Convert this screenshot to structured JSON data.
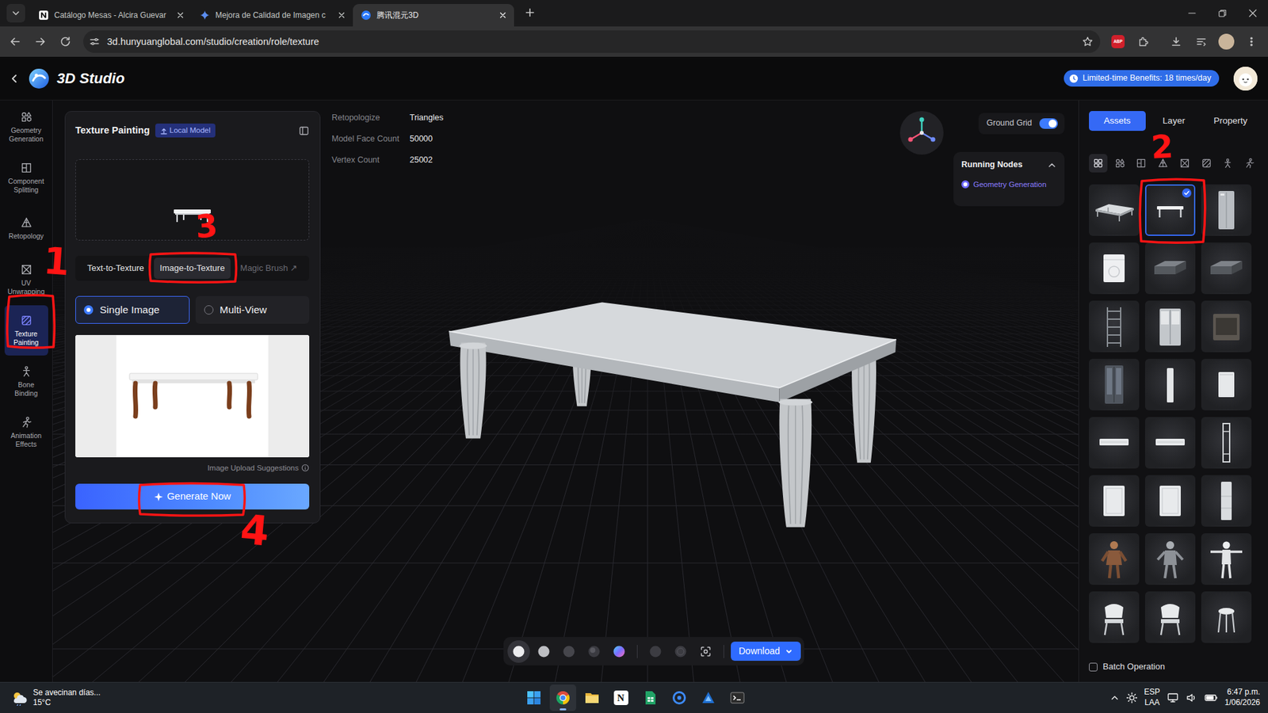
{
  "browser": {
    "tabs": [
      {
        "label": "Catálogo Mesas - Alcira Guevar",
        "selected": false
      },
      {
        "label": "Mejora de Calidad de Imagen c",
        "selected": false
      },
      {
        "label": "腾讯混元3D",
        "selected": true
      }
    ],
    "url": "3d.hunyuanglobal.com/studio/creation/role/texture",
    "extension_badge": "ABP"
  },
  "app": {
    "title": "3D Studio",
    "benefits": "Limited-time Benefits: 18 times/day"
  },
  "rail": [
    {
      "label": "Geometry Generation",
      "kind": "geometry",
      "selected": false
    },
    {
      "label": "Component Splitting",
      "kind": "component",
      "selected": false
    },
    {
      "label": "Retopology",
      "kind": "retopo",
      "selected": false
    },
    {
      "label": "UV Unwrapping",
      "kind": "uv",
      "selected": false
    },
    {
      "label": "Texture Painting",
      "kind": "texture",
      "selected": true
    },
    {
      "label": "Bone Binding",
      "kind": "bone",
      "selected": false
    },
    {
      "label": "Animation Effects",
      "kind": "animation",
      "selected": false
    }
  ],
  "panel": {
    "title": "Texture Painting",
    "badge": "Local Model",
    "modes": [
      {
        "label": "Text-to-Texture",
        "selected": false,
        "disabled": false
      },
      {
        "label": "Image-to-Texture",
        "selected": true,
        "disabled": false
      },
      {
        "label": "Magic Brush ↗",
        "selected": false,
        "disabled": true
      }
    ],
    "views": [
      {
        "label": "Single Image",
        "selected": true
      },
      {
        "label": "Multi-View",
        "selected": false
      }
    ],
    "hint": "Image Upload Suggestions",
    "generate": "Generate Now"
  },
  "stats": [
    {
      "label": "Retopologize",
      "value": "Triangles"
    },
    {
      "label": "Model Face Count",
      "value": "50000"
    },
    {
      "label": "Vertex Count",
      "value": "25002"
    }
  ],
  "ground_grid": {
    "label": "Ground Grid",
    "on": true
  },
  "running_nodes": {
    "title": "Running Nodes",
    "expanded": true,
    "items": [
      {
        "label": "Geometry Generation",
        "running": true
      }
    ]
  },
  "toolbar": {
    "modes": [
      {
        "kind": "solid",
        "selected": true
      },
      {
        "kind": "clay",
        "selected": false
      },
      {
        "kind": "dark",
        "selected": false
      },
      {
        "kind": "shadow",
        "selected": false
      },
      {
        "kind": "color",
        "selected": false
      },
      {
        "kind": "normal",
        "selected": false
      },
      {
        "kind": "wire",
        "selected": false
      },
      {
        "kind": "capture",
        "selected": false
      }
    ],
    "download": "Download"
  },
  "right_tabs": [
    {
      "label": "Assets",
      "selected": true
    },
    {
      "label": "Layer",
      "selected": false
    },
    {
      "label": "Property",
      "selected": false
    }
  ],
  "filters": [
    {
      "kind": "all",
      "selected": true
    },
    {
      "kind": "geometry",
      "selected": false
    },
    {
      "kind": "component",
      "selected": false
    },
    {
      "kind": "retopo",
      "selected": false
    },
    {
      "kind": "uv",
      "selected": false
    },
    {
      "kind": "texture",
      "selected": false
    },
    {
      "kind": "bone",
      "selected": false
    },
    {
      "kind": "animation",
      "selected": false
    }
  ],
  "assets": [
    {
      "kind": "table",
      "selected": false
    },
    {
      "kind": "bench",
      "selected": true
    },
    {
      "kind": "tall-cabinet",
      "selected": false
    },
    {
      "kind": "box",
      "selected": false
    },
    {
      "kind": "flat-box",
      "selected": false
    },
    {
      "kind": "flat-box",
      "selected": false
    },
    {
      "kind": "rack",
      "selected": false
    },
    {
      "kind": "wide-cabinet",
      "selected": false
    },
    {
      "kind": "dark-box",
      "selected": false
    },
    {
      "kind": "locker",
      "selected": false
    },
    {
      "kind": "slim",
      "selected": false
    },
    {
      "kind": "panel",
      "selected": false
    },
    {
      "kind": "shelf",
      "selected": false
    },
    {
      "kind": "shelf",
      "selected": false
    },
    {
      "kind": "frame",
      "selected": false
    },
    {
      "kind": "door-cabinet",
      "selected": false
    },
    {
      "kind": "door-cabinet",
      "selected": false
    },
    {
      "kind": "slim-locker",
      "selected": false
    },
    {
      "kind": "warrior",
      "selected": false
    },
    {
      "kind": "figure",
      "selected": false
    },
    {
      "kind": "tpose",
      "selected": false
    },
    {
      "kind": "chair",
      "selected": false
    },
    {
      "kind": "chair",
      "selected": false
    },
    {
      "kind": "stool",
      "selected": false
    }
  ],
  "batch": {
    "label": "Batch Operation",
    "checked": false
  },
  "annotations": [
    {
      "label": "1"
    },
    {
      "label": "2"
    },
    {
      "label": "3"
    },
    {
      "label": "4"
    }
  ],
  "taskbar": {
    "weather": {
      "title": "Se avecinan días...",
      "temp": "15°C"
    },
    "apps": [
      {
        "kind": "windows",
        "selected": false
      },
      {
        "kind": "chrome",
        "selected": true
      },
      {
        "kind": "explorer",
        "selected": false
      },
      {
        "kind": "notion",
        "glyph": "N",
        "selected": false
      },
      {
        "kind": "sheets",
        "selected": false
      },
      {
        "kind": "vpn",
        "selected": false
      },
      {
        "kind": "affinity",
        "selected": false
      },
      {
        "kind": "terminal",
        "selected": false
      }
    ],
    "lang": "ESP",
    "layout": "LAA",
    "time": "6:47 p.m.",
    "date": "1/06/2026"
  }
}
